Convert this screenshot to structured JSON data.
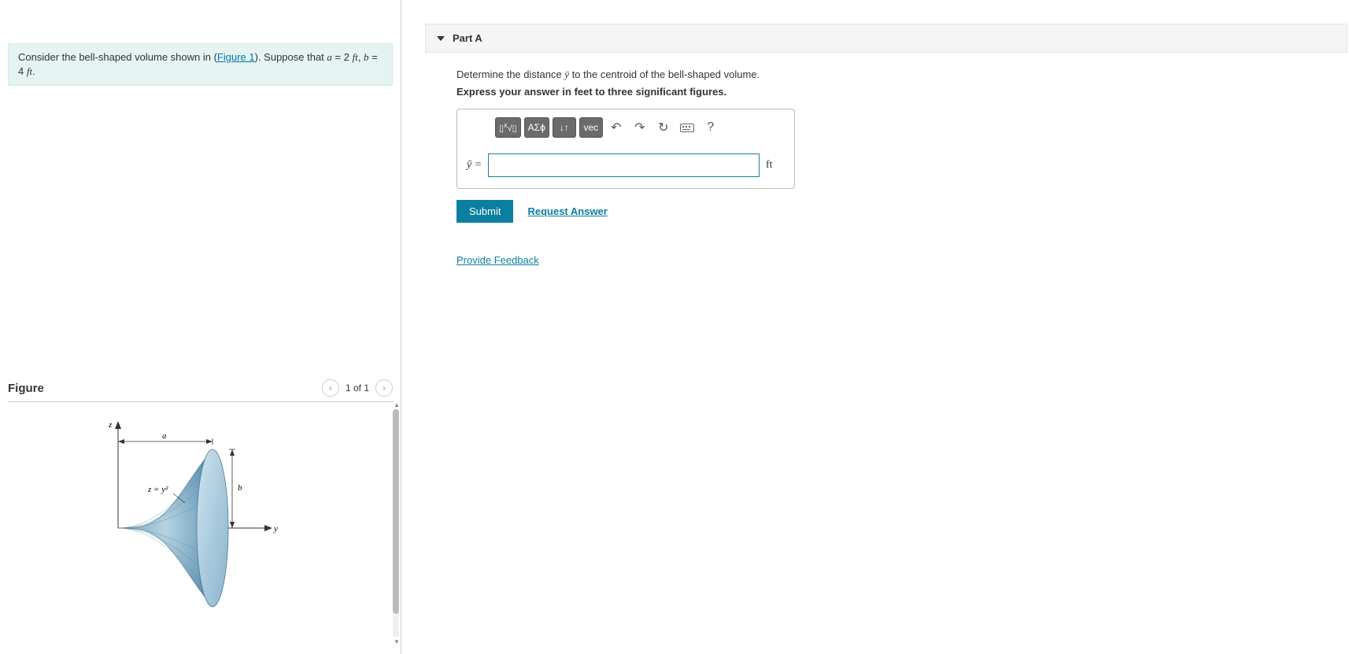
{
  "problem": {
    "prefix": "Consider the bell-shaped volume shown in (",
    "figure_link": "Figure 1",
    "mid": "). Suppose that ",
    "a_var": "a",
    "eq1": " = 2 ",
    "unit1": "ft",
    "sep": ", ",
    "b_var": "b",
    "eq2": " = 4 ",
    "unit2": "ft",
    "suffix": "."
  },
  "figure": {
    "title": "Figure",
    "page_label": "1 of 1",
    "labels": {
      "z": "z",
      "y": "y",
      "a": "a",
      "b": "b",
      "curve": "z = y²"
    }
  },
  "part": {
    "title": "Part A",
    "instruction_pre": "Determine the distance ",
    "ybar": "ȳ",
    "instruction_post": " to the centroid of the bell-shaped volume.",
    "hint": "Express your answer in feet to three significant figures.",
    "lhs": "ȳ =",
    "unit": "ft",
    "submit": "Submit",
    "request": "Request Answer",
    "feedback": "Provide Feedback"
  },
  "toolbar": {
    "templates": "▯√▯",
    "greek": "ΑΣϕ",
    "scripts": "↓↑",
    "vec": "vec",
    "undo": "↶",
    "redo": "↷",
    "reset": "↻",
    "help": "?"
  }
}
